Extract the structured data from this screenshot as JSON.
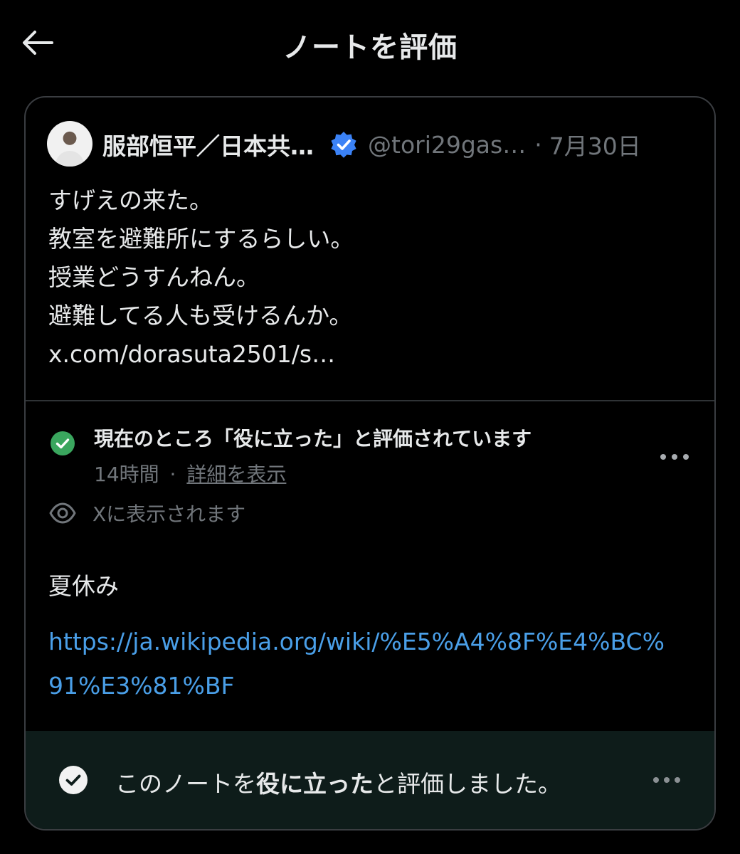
{
  "header": {
    "title": "ノートを評価",
    "back_icon": "arrow-left-icon"
  },
  "tweet": {
    "author_name": "服部恒平／日本共…",
    "handle": "@tori29gas…",
    "separator": "·",
    "date": "7月30日",
    "verified_color": "#3b82f6",
    "text_lines": [
      "すげえの来た。",
      "教室を避難所にするらしい。",
      "授業どうすんねん。",
      "避難してる人も受けるんか。",
      "x.com/dorasuta2501/s…"
    ]
  },
  "note_status": {
    "title": "現在のところ「役に立った」と評価されています",
    "time": "14時間",
    "separator": "·",
    "details_link": "詳細を表示",
    "check_color": "#3aa65e",
    "visibility_label": "Xに表示されます"
  },
  "note": {
    "text": "夏休み",
    "link": "https://ja.wikipedia.org/wiki/%E5%A4%8F%E4%BC%91%E3%81%BF",
    "link_color": "#4a9fe8"
  },
  "rating": {
    "prefix": "このノートを",
    "emphasis": "役に立った",
    "suffix": "と評価しました。",
    "bar_color": "#0e1c1a"
  }
}
